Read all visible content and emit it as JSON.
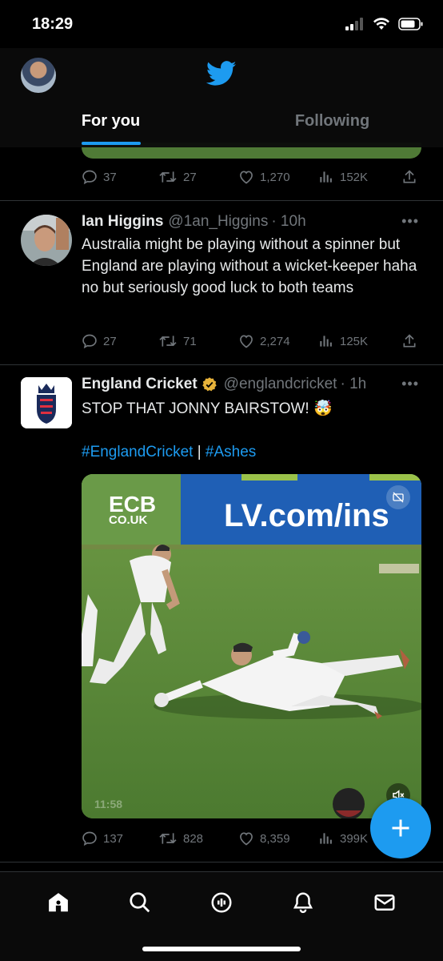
{
  "status_bar": {
    "time": "18:29"
  },
  "header": {
    "tabs": [
      {
        "label": "For you",
        "active": true
      },
      {
        "label": "Following",
        "active": false
      }
    ]
  },
  "prev_tweet": {
    "replies": "37",
    "retweets": "27",
    "likes": "1,270",
    "views": "152K"
  },
  "tweets": [
    {
      "name": "Ian Higgins",
      "handle": "@1an_Higgins",
      "time": "· 10h",
      "text": "Australia might be playing without a spinner but England are playing without a wicket-keeper haha no but seriously good luck to both teams",
      "replies": "27",
      "retweets": "71",
      "likes": "2,274",
      "views": "125K"
    },
    {
      "name": "England Cricket",
      "handle": "@englandcricket",
      "time": "· 1h",
      "text": "STOP THAT JONNY BAIRSTOW! 🤯",
      "hashtag_1": "#EnglandCricket",
      "hashtag_sep": " | ",
      "hashtag_2": "#Ashes",
      "video": {
        "banner_left_1": "ECB",
        "banner_left_2": "CO.UK",
        "banner_right": "LV.com/ins",
        "timestamp": "11:58"
      },
      "replies": "137",
      "retweets": "828",
      "likes": "8,359",
      "views": "399K"
    }
  ],
  "accent_color": "#1d9bf0",
  "verified_color": "#e8b33a",
  "bottom_nav": [
    "home-icon",
    "search-icon",
    "spaces-icon",
    "notifications-icon",
    "messages-icon"
  ]
}
